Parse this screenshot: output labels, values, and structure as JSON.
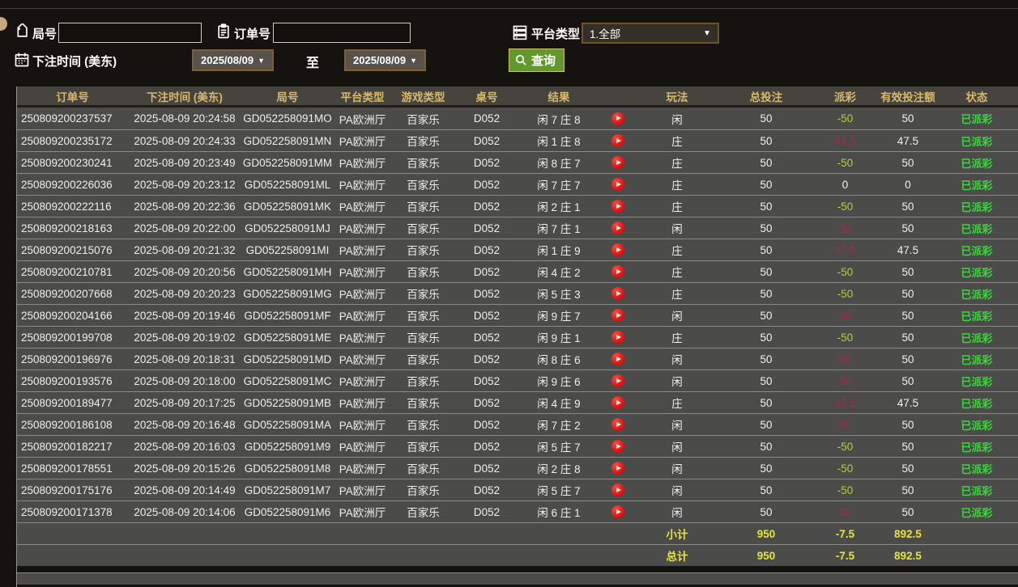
{
  "filters": {
    "round_label": "局号",
    "round_value": "",
    "order_label": "订单号",
    "order_value": "",
    "platform_label": "平台类型",
    "platform_selected": "1.全部",
    "bet_time_label": "下注时间 (美东)",
    "date_from": "2025/08/09",
    "date_to": "2025/08/09",
    "to_label": "至",
    "query_label": "查询"
  },
  "colors": {
    "header_gold": "#d7b96b",
    "status_green": "#3fd43f",
    "payout_negative_green": "#a8d437",
    "payout_positive_red": "#a42b47",
    "totals_yellow": "#e9e43a",
    "query_button_green": "#61992e",
    "play_button_red": "#d90f0f"
  },
  "table": {
    "headers": [
      "订单号",
      "下注时间 (美东)",
      "局号",
      "平台类型",
      "游戏类型",
      "桌号",
      "结果",
      "玩法",
      "总投注",
      "派彩",
      "有效投注额",
      "状态"
    ],
    "rows": [
      {
        "order_id": "250809200237537",
        "bet_time": "2025-08-09 20:24:58",
        "round_id": "GD052258091MO",
        "platform": "PA欧洲厅",
        "game_type": "百家乐",
        "table_no": "D052",
        "result": "闲 7 庄 8",
        "bet_type": "闲",
        "total_bet": "50",
        "payout": "-50",
        "valid_bet": "50",
        "status": "已派彩"
      },
      {
        "order_id": "250809200235172",
        "bet_time": "2025-08-09 20:24:33",
        "round_id": "GD052258091MN",
        "platform": "PA欧洲厅",
        "game_type": "百家乐",
        "table_no": "D052",
        "result": "闲 1 庄 8",
        "bet_type": "庄",
        "total_bet": "50",
        "payout": "47.5",
        "valid_bet": "47.5",
        "status": "已派彩"
      },
      {
        "order_id": "250809200230241",
        "bet_time": "2025-08-09 20:23:49",
        "round_id": "GD052258091MM",
        "platform": "PA欧洲厅",
        "game_type": "百家乐",
        "table_no": "D052",
        "result": "闲 8 庄 7",
        "bet_type": "庄",
        "total_bet": "50",
        "payout": "-50",
        "valid_bet": "50",
        "status": "已派彩"
      },
      {
        "order_id": "250809200226036",
        "bet_time": "2025-08-09 20:23:12",
        "round_id": "GD052258091ML",
        "platform": "PA欧洲厅",
        "game_type": "百家乐",
        "table_no": "D052",
        "result": "闲 7 庄 7",
        "bet_type": "庄",
        "total_bet": "50",
        "payout": "0",
        "valid_bet": "0",
        "status": "已派彩"
      },
      {
        "order_id": "250809200222116",
        "bet_time": "2025-08-09 20:22:36",
        "round_id": "GD052258091MK",
        "platform": "PA欧洲厅",
        "game_type": "百家乐",
        "table_no": "D052",
        "result": "闲 2 庄 1",
        "bet_type": "庄",
        "total_bet": "50",
        "payout": "-50",
        "valid_bet": "50",
        "status": "已派彩"
      },
      {
        "order_id": "250809200218163",
        "bet_time": "2025-08-09 20:22:00",
        "round_id": "GD052258091MJ",
        "platform": "PA欧洲厅",
        "game_type": "百家乐",
        "table_no": "D052",
        "result": "闲 7 庄 1",
        "bet_type": "闲",
        "total_bet": "50",
        "payout": "50",
        "valid_bet": "50",
        "status": "已派彩"
      },
      {
        "order_id": "250809200215076",
        "bet_time": "2025-08-09 20:21:32",
        "round_id": "GD052258091MI",
        "platform": "PA欧洲厅",
        "game_type": "百家乐",
        "table_no": "D052",
        "result": "闲 1 庄 9",
        "bet_type": "庄",
        "total_bet": "50",
        "payout": "47.5",
        "valid_bet": "47.5",
        "status": "已派彩"
      },
      {
        "order_id": "250809200210781",
        "bet_time": "2025-08-09 20:20:56",
        "round_id": "GD052258091MH",
        "platform": "PA欧洲厅",
        "game_type": "百家乐",
        "table_no": "D052",
        "result": "闲 4 庄 2",
        "bet_type": "庄",
        "total_bet": "50",
        "payout": "-50",
        "valid_bet": "50",
        "status": "已派彩"
      },
      {
        "order_id": "250809200207668",
        "bet_time": "2025-08-09 20:20:23",
        "round_id": "GD052258091MG",
        "platform": "PA欧洲厅",
        "game_type": "百家乐",
        "table_no": "D052",
        "result": "闲 5 庄 3",
        "bet_type": "庄",
        "total_bet": "50",
        "payout": "-50",
        "valid_bet": "50",
        "status": "已派彩"
      },
      {
        "order_id": "250809200204166",
        "bet_time": "2025-08-09 20:19:46",
        "round_id": "GD052258091MF",
        "platform": "PA欧洲厅",
        "game_type": "百家乐",
        "table_no": "D052",
        "result": "闲 9 庄 7",
        "bet_type": "闲",
        "total_bet": "50",
        "payout": "50",
        "valid_bet": "50",
        "status": "已派彩"
      },
      {
        "order_id": "250809200199708",
        "bet_time": "2025-08-09 20:19:02",
        "round_id": "GD052258091ME",
        "platform": "PA欧洲厅",
        "game_type": "百家乐",
        "table_no": "D052",
        "result": "闲 9 庄 1",
        "bet_type": "庄",
        "total_bet": "50",
        "payout": "-50",
        "valid_bet": "50",
        "status": "已派彩"
      },
      {
        "order_id": "250809200196976",
        "bet_time": "2025-08-09 20:18:31",
        "round_id": "GD052258091MD",
        "platform": "PA欧洲厅",
        "game_type": "百家乐",
        "table_no": "D052",
        "result": "闲 8 庄 6",
        "bet_type": "闲",
        "total_bet": "50",
        "payout": "50",
        "valid_bet": "50",
        "status": "已派彩"
      },
      {
        "order_id": "250809200193576",
        "bet_time": "2025-08-09 20:18:00",
        "round_id": "GD052258091MC",
        "platform": "PA欧洲厅",
        "game_type": "百家乐",
        "table_no": "D052",
        "result": "闲 9 庄 6",
        "bet_type": "闲",
        "total_bet": "50",
        "payout": "50",
        "valid_bet": "50",
        "status": "已派彩"
      },
      {
        "order_id": "250809200189477",
        "bet_time": "2025-08-09 20:17:25",
        "round_id": "GD052258091MB",
        "platform": "PA欧洲厅",
        "game_type": "百家乐",
        "table_no": "D052",
        "result": "闲 4 庄 9",
        "bet_type": "庄",
        "total_bet": "50",
        "payout": "47.5",
        "valid_bet": "47.5",
        "status": "已派彩"
      },
      {
        "order_id": "250809200186108",
        "bet_time": "2025-08-09 20:16:48",
        "round_id": "GD052258091MA",
        "platform": "PA欧洲厅",
        "game_type": "百家乐",
        "table_no": "D052",
        "result": "闲 7 庄 2",
        "bet_type": "闲",
        "total_bet": "50",
        "payout": "50",
        "valid_bet": "50",
        "status": "已派彩"
      },
      {
        "order_id": "250809200182217",
        "bet_time": "2025-08-09 20:16:03",
        "round_id": "GD052258091M9",
        "platform": "PA欧洲厅",
        "game_type": "百家乐",
        "table_no": "D052",
        "result": "闲 5 庄 7",
        "bet_type": "闲",
        "total_bet": "50",
        "payout": "-50",
        "valid_bet": "50",
        "status": "已派彩"
      },
      {
        "order_id": "250809200178551",
        "bet_time": "2025-08-09 20:15:26",
        "round_id": "GD052258091M8",
        "platform": "PA欧洲厅",
        "game_type": "百家乐",
        "table_no": "D052",
        "result": "闲 2 庄 8",
        "bet_type": "闲",
        "total_bet": "50",
        "payout": "-50",
        "valid_bet": "50",
        "status": "已派彩"
      },
      {
        "order_id": "250809200175176",
        "bet_time": "2025-08-09 20:14:49",
        "round_id": "GD052258091M7",
        "platform": "PA欧洲厅",
        "game_type": "百家乐",
        "table_no": "D052",
        "result": "闲 5 庄 7",
        "bet_type": "闲",
        "total_bet": "50",
        "payout": "-50",
        "valid_bet": "50",
        "status": "已派彩"
      },
      {
        "order_id": "250809200171378",
        "bet_time": "2025-08-09 20:14:06",
        "round_id": "GD052258091M6",
        "platform": "PA欧洲厅",
        "game_type": "百家乐",
        "table_no": "D052",
        "result": "闲 6 庄 1",
        "bet_type": "闲",
        "total_bet": "50",
        "payout": "50",
        "valid_bet": "50",
        "status": "已派彩"
      }
    ],
    "subtotal": {
      "label": "小计",
      "total_bet": "950",
      "payout": "-7.5",
      "valid_bet": "892.5"
    },
    "total": {
      "label": "总计",
      "total_bet": "950",
      "payout": "-7.5",
      "valid_bet": "892.5"
    }
  }
}
